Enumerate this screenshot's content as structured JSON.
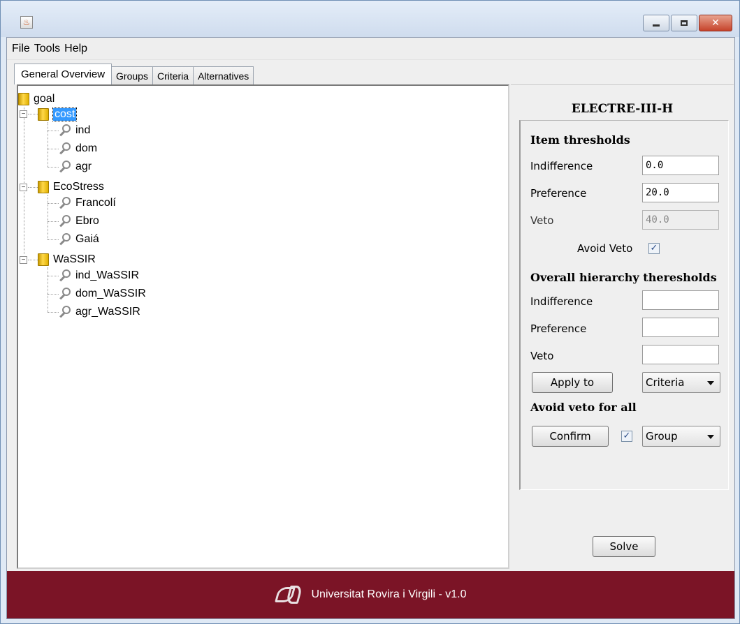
{
  "window": {
    "icon": "java-cup-icon"
  },
  "menu": [
    "File",
    "Tools",
    "Help"
  ],
  "tabs": [
    "General Overview",
    "Groups",
    "Criteria",
    "Alternatives"
  ],
  "tree": {
    "root": "goal",
    "groups": [
      {
        "label": "cost",
        "selected": true,
        "children": [
          "ind",
          "dom",
          "agr"
        ]
      },
      {
        "label": "EcoStress",
        "selected": false,
        "children": [
          "Francolí",
          "Ebro",
          "Gaiá"
        ]
      },
      {
        "label": "WaSSIR",
        "selected": false,
        "children": [
          "ind_WaSSIR",
          "dom_WaSSIR",
          "agr_WaSSIR"
        ]
      }
    ]
  },
  "side": {
    "title": "ELECTRE-III-H",
    "item_thresholds": {
      "heading": "Item thresholds",
      "indifference_label": "Indifference",
      "indifference_value": "0.0",
      "preference_label": "Preference",
      "preference_value": "20.0",
      "veto_label": "Veto",
      "veto_value": "40.0",
      "avoid_veto_label": "Avoid Veto",
      "avoid_veto_checked": "✓"
    },
    "overall": {
      "heading": "Overall hierarchy theresholds",
      "indifference_label": "Indifference",
      "indifference_value": "",
      "preference_label": "Preference",
      "preference_value": "",
      "veto_label": "Veto",
      "veto_value": "",
      "apply_label": "Apply to",
      "apply_combo": "Criteria"
    },
    "avoid_all": {
      "heading": "Avoid veto for all",
      "confirm_label": "Confirm",
      "checked": "✓",
      "combo": "Group"
    },
    "solve_label": "Solve"
  },
  "footer": {
    "text": "Universitat Rovira i Virgili - v1.0"
  },
  "colors": {
    "footer_bg": "#7b1426",
    "selection": "#3399ff"
  }
}
